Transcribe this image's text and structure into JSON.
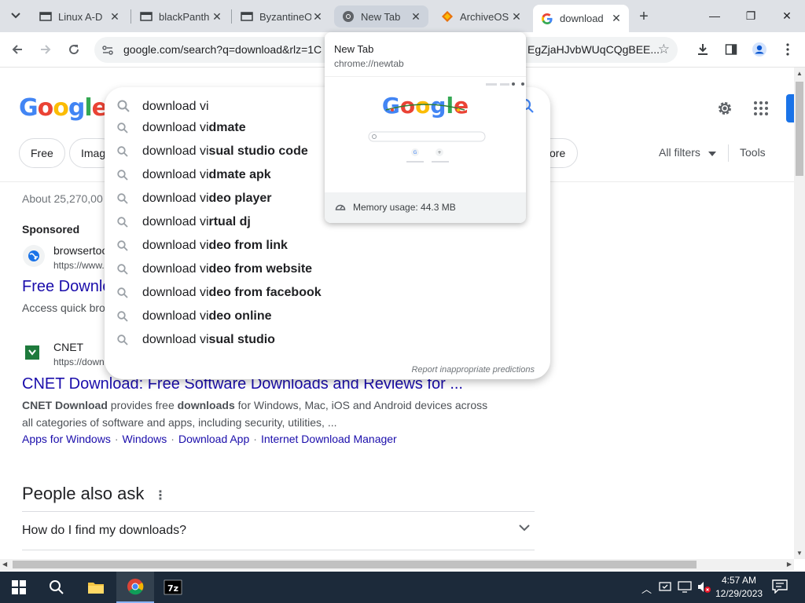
{
  "tabs": [
    {
      "title": "Linux A-D",
      "favicon": "window-icon"
    },
    {
      "title": "blackPanth",
      "favicon": "window-icon"
    },
    {
      "title": "ByzantineO",
      "favicon": "window-icon"
    },
    {
      "title": "New Tab",
      "favicon": "chrome-icon"
    },
    {
      "title": "ArchiveOS",
      "favicon": "diamond-icon"
    },
    {
      "title": "download",
      "favicon": "google-icon"
    }
  ],
  "window_controls": {
    "minimize": "—",
    "maximize": "❐",
    "close": "✕"
  },
  "omnibox": {
    "url": "google.com/search?q=download&rlz=1C",
    "url_tail": "EgZjaHJvbWUqCQgBEE..."
  },
  "logo_letters": [
    "G",
    "o",
    "o",
    "g",
    "l",
    "e"
  ],
  "search": {
    "query": "download vi",
    "suggestions": [
      {
        "prefix": "download vi",
        "completion": "dmate"
      },
      {
        "prefix": "download vi",
        "completion": "sual studio code"
      },
      {
        "prefix": "download vi",
        "completion": "dmate apk"
      },
      {
        "prefix": "download vi",
        "completion": "deo player"
      },
      {
        "prefix": "download vi",
        "completion": "rtual dj"
      },
      {
        "prefix": "download vi",
        "completion": "deo from link"
      },
      {
        "prefix": "download vi",
        "completion": "deo from website"
      },
      {
        "prefix": "download vi",
        "completion": "deo from facebook"
      },
      {
        "prefix": "download vi",
        "completion": "deo online"
      },
      {
        "prefix": "download vi",
        "completion": "sual studio"
      }
    ],
    "report_text": "Report inappropriate predictions"
  },
  "chips": {
    "free": "Free",
    "images": "Imag",
    "more": "ore"
  },
  "filters": {
    "all_filters": "All filters",
    "tools": "Tools"
  },
  "results": {
    "stats": "About 25,270,00",
    "sponsored": "Sponsored",
    "ad": {
      "site": "browsertoo",
      "url": "https://www.",
      "title": "Free Downlo",
      "desc": "Access quick bro"
    },
    "cnet": {
      "site": "CNET",
      "url": "https://down",
      "title": "CNET Download: Free Software Downloads and Reviews for ...",
      "desc_1": "CNET",
      "desc_2": "Download",
      "desc_3": "provides free",
      "desc_4": "downloads",
      "desc_5": "for Windows, Mac, iOS and Android devices across",
      "desc_6": "all categories of software and apps, including security, utilities, ...",
      "sitelinks": [
        "Apps for Windows",
        "Windows",
        "Download App",
        "Internet Download Manager"
      ]
    }
  },
  "paa": {
    "title": "People also ask",
    "question": "How do I find my downloads?"
  },
  "hovercard": {
    "title": "New Tab",
    "url": "chrome://newtab",
    "memory": "Memory usage: 44.3 MB"
  },
  "taskbar": {
    "time": "4:57 AM",
    "date": "12/29/2023",
    "bg_hint": "Search Google or type a URL"
  },
  "colors": {
    "link": "#1a0dab",
    "accent": "#1a73e8",
    "taskbar": "#1c2a3a"
  }
}
